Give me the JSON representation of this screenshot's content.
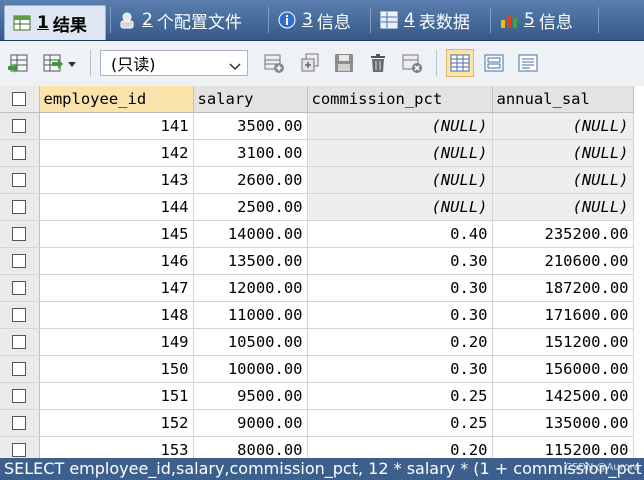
{
  "tabs": [
    {
      "num": "1",
      "label": "结果",
      "active": true,
      "icon": "result-grid-icon"
    },
    {
      "num": "2",
      "label": "个配置文件",
      "active": false,
      "icon": "profile-icon"
    },
    {
      "num": "3",
      "label": "信息",
      "active": false,
      "icon": "info-icon"
    },
    {
      "num": "4",
      "label": "表数据",
      "active": false,
      "icon": "table-data-icon"
    },
    {
      "num": "5",
      "label": "信息",
      "active": false,
      "icon": "info-chart-icon"
    }
  ],
  "toolbar": {
    "mode_select": "(只读)"
  },
  "table": {
    "columns": [
      "employee_id",
      "salary",
      "commission_pct",
      "annual_sal"
    ],
    "rows": [
      [
        "141",
        "3500.00",
        "(NULL)",
        "(NULL)"
      ],
      [
        "142",
        "3100.00",
        "(NULL)",
        "(NULL)"
      ],
      [
        "143",
        "2600.00",
        "(NULL)",
        "(NULL)"
      ],
      [
        "144",
        "2500.00",
        "(NULL)",
        "(NULL)"
      ],
      [
        "145",
        "14000.00",
        "0.40",
        "235200.00"
      ],
      [
        "146",
        "13500.00",
        "0.30",
        "210600.00"
      ],
      [
        "147",
        "12000.00",
        "0.30",
        "187200.00"
      ],
      [
        "148",
        "11000.00",
        "0.30",
        "171600.00"
      ],
      [
        "149",
        "10500.00",
        "0.20",
        "151200.00"
      ],
      [
        "150",
        "10000.00",
        "0.30",
        "156000.00"
      ],
      [
        "151",
        "9500.00",
        "0.25",
        "142500.00"
      ],
      [
        "152",
        "9000.00",
        "0.25",
        "135000.00"
      ],
      [
        "153",
        "8000.00",
        "0.20",
        "115200.00"
      ]
    ]
  },
  "status": {
    "query": "SELECT employee_id,salary,commission_pct, 12 * salary * (1 + commission_pct"
  },
  "watermark": "CSDN @Aurora",
  "colors": {
    "tabbar": "#3a5f8c",
    "header_active": "#fbe3ac",
    "null_cell": "#eeeeee"
  }
}
